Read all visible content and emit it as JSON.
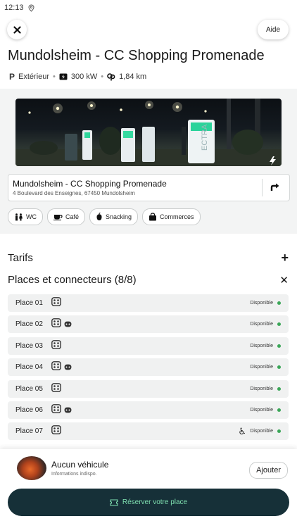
{
  "status_bar": {
    "time": "12:13"
  },
  "header": {
    "help_label": "Aide"
  },
  "station": {
    "title": "Mundolsheim - CC Shopping Promenade",
    "location_type": "Extérieur",
    "power": "300 kW",
    "distance": "1,84 km",
    "photo_brand": "ECTRA",
    "address_name": "Mundolsheim - CC Shopping Promenade",
    "address_line": "4 Boulevard des Enseignes, 67450 Mundolsheim"
  },
  "amenities": [
    {
      "icon": "wc-icon",
      "label": "WC"
    },
    {
      "icon": "coffee-icon",
      "label": "Café"
    },
    {
      "icon": "snack-icon",
      "label": "Snacking"
    },
    {
      "icon": "shopping-bag-icon",
      "label": "Commerces"
    }
  ],
  "sections": {
    "tarifs_label": "Tarifs",
    "places_label": "Places et connecteurs (8/8)"
  },
  "places": [
    {
      "name": "Place 01",
      "connectors": 1,
      "accessible": false,
      "status": "Disponible"
    },
    {
      "name": "Place 02",
      "connectors": 2,
      "accessible": false,
      "status": "Disponible"
    },
    {
      "name": "Place 03",
      "connectors": 1,
      "accessible": false,
      "status": "Disponible"
    },
    {
      "name": "Place 04",
      "connectors": 2,
      "accessible": false,
      "status": "Disponible"
    },
    {
      "name": "Place 05",
      "connectors": 1,
      "accessible": false,
      "status": "Disponible"
    },
    {
      "name": "Place 06",
      "connectors": 2,
      "accessible": false,
      "status": "Disponible"
    },
    {
      "name": "Place 07",
      "connectors": 1,
      "accessible": true,
      "status": "Disponible"
    }
  ],
  "vehicle": {
    "title": "Aucun véhicule",
    "subtitle": "Informations indispo.",
    "add_label": "Ajouter"
  },
  "reserve": {
    "label": "Réserver votre place"
  },
  "colors": {
    "accent_dark": "#163038",
    "accent_green": "#7fe0b0",
    "available": "#3aa657"
  }
}
